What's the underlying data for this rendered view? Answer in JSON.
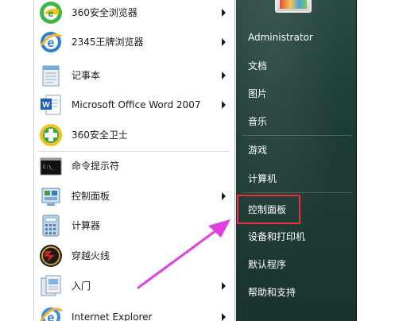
{
  "programs": [
    {
      "label": "360安全浏览器",
      "icon": "360-browser-icon",
      "has_submenu": true
    },
    {
      "label": "2345王牌浏览器",
      "icon": "2345-browser-icon",
      "has_submenu": true
    },
    {
      "label": "记事本",
      "icon": "notepad-icon",
      "has_submenu": true
    },
    {
      "label": "Microsoft Office Word 2007",
      "icon": "word-icon",
      "has_submenu": true
    },
    {
      "label": "360安全卫士",
      "icon": "360-safe-icon",
      "has_submenu": false
    },
    {
      "label": "命令提示符",
      "icon": "cmd-icon",
      "has_submenu": false
    },
    {
      "label": "控制面板",
      "icon": "control-panel-icon",
      "has_submenu": true
    },
    {
      "label": "计算器",
      "icon": "calculator-icon",
      "has_submenu": false
    },
    {
      "label": "穿越火线",
      "icon": "crossfire-icon",
      "has_submenu": false
    },
    {
      "label": "入门",
      "icon": "getting-started-icon",
      "has_submenu": true
    },
    {
      "label": "Internet Explorer",
      "icon": "ie-icon",
      "has_submenu": true
    }
  ],
  "right_menu": {
    "user": "Administrator",
    "items": [
      "文档",
      "图片",
      "音乐",
      "游戏",
      "计算机",
      "控制面板",
      "设备和打印机",
      "默认程序",
      "帮助和支持"
    ],
    "highlighted": "控制面板"
  },
  "colors": {
    "highlight_box": "#e8313a",
    "annotation_arrow": "#e040e0"
  }
}
